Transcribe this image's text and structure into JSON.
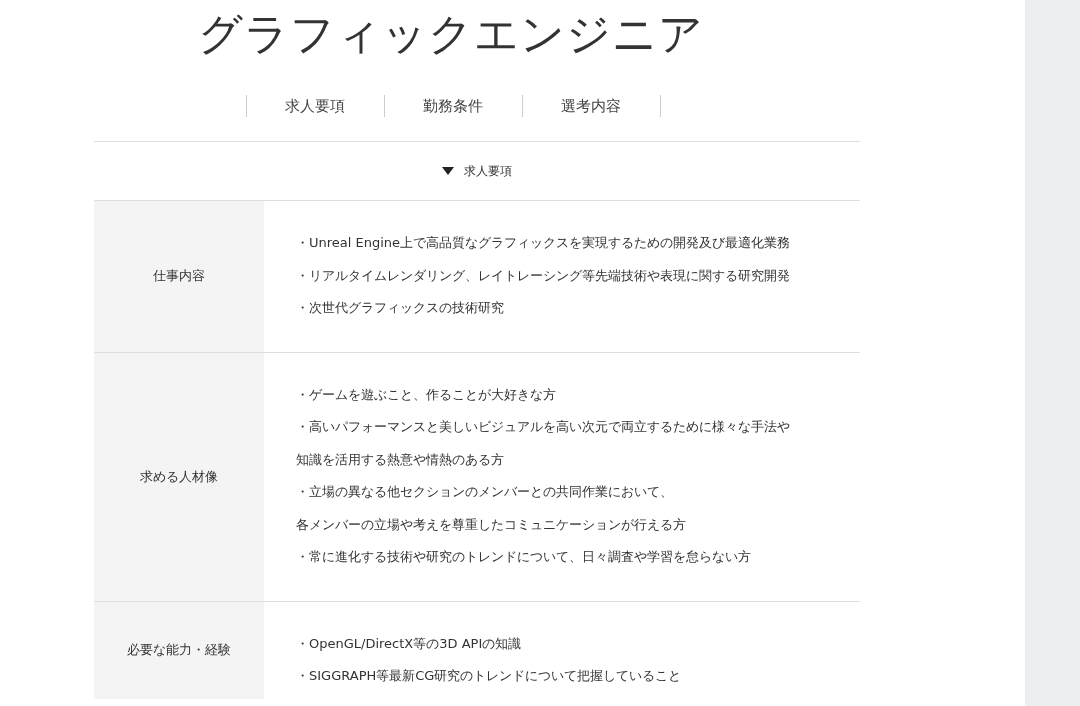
{
  "title": "グラフィックエンジニア",
  "tabs": [
    {
      "label": "求人要項"
    },
    {
      "label": "勤務条件"
    },
    {
      "label": "選考内容"
    }
  ],
  "section": {
    "label": "求人要項",
    "expanded": true
  },
  "rows": [
    {
      "label": "仕事内容",
      "lines": [
        "・Unreal Engine上で高品質なグラフィックスを実現するための開発及び最適化業務",
        "・リアルタイムレンダリング、レイトレーシング等先端技術や表現に関する研究開発",
        "・次世代グラフィックスの技術研究"
      ]
    },
    {
      "label": "求める人材像",
      "lines": [
        "・ゲームを遊ぶこと、作ることが大好きな方",
        "・高いパフォーマンスと美しいビジュアルを高い次元で両立するために様々な手法や",
        "知識を活用する熱意や情熱のある方",
        "・立場の異なる他セクションのメンバーとの共同作業において、",
        "各メンバーの立場や考えを尊重したコミュニケーションが行える方",
        "・常に進化する技術や研究のトレンドについて、日々調査や学習を怠らない方"
      ]
    },
    {
      "label": "必要な能力・経験",
      "lines": [
        "・OpenGL/DirectX等の3D APIの知識",
        "・SIGGRAPH等最新CG研究のトレンドについて把握していること"
      ]
    }
  ]
}
